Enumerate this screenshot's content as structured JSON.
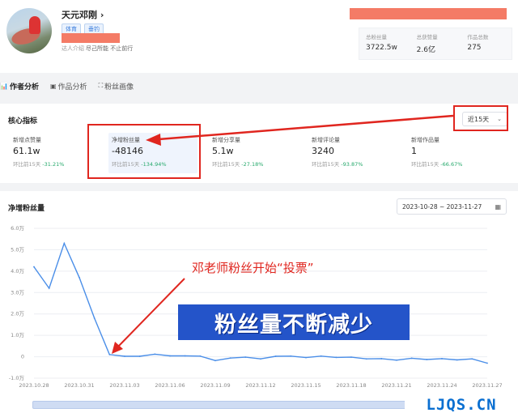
{
  "profile": {
    "name": "天元邓刚",
    "name_chevron": "›",
    "tags": [
      "体育",
      "垂钓"
    ],
    "intro_label": "达人介绍",
    "intro_text": "尽己所能 不止前行"
  },
  "stats": [
    {
      "label": "总粉丝量",
      "value": "3722.5w"
    },
    {
      "label": "总获赞量",
      "value": "2.6亿"
    },
    {
      "label": "作品总数",
      "value": "275"
    }
  ],
  "tabs": [
    {
      "icon": "📊",
      "label": "作者分析"
    },
    {
      "icon": "▣",
      "label": "作品分析"
    },
    {
      "icon": "⛶",
      "label": "粉丝画像"
    }
  ],
  "core": {
    "title": "核心指标",
    "range_value": "近15天",
    "compare_label": "环比前15天",
    "metrics": [
      {
        "label": "新增点赞量",
        "value": "61.1w",
        "change": "-31.21%"
      },
      {
        "label": "净增粉丝量",
        "value": "-48146",
        "change": "-134.94%"
      },
      {
        "label": "新增分享量",
        "value": "5.1w",
        "change": "-27.18%"
      },
      {
        "label": "新增评论量",
        "value": "3240",
        "change": "-93.87%"
      },
      {
        "label": "新增作品量",
        "value": "1",
        "change": "-66.67%"
      }
    ]
  },
  "chart_section": {
    "title": "净增粉丝量",
    "date_range": "2023-10-28 ~ 2023-11-27"
  },
  "chart_data": {
    "type": "line",
    "x": [
      "2023.10.28",
      "2023.10.29",
      "2023.10.30",
      "2023.10.31",
      "2023.11.01",
      "2023.11.02",
      "2023.11.03",
      "2023.11.04",
      "2023.11.05",
      "2023.11.06",
      "2023.11.07",
      "2023.11.08",
      "2023.11.09",
      "2023.11.10",
      "2023.11.11",
      "2023.11.12",
      "2023.11.13",
      "2023.11.14",
      "2023.11.15",
      "2023.11.16",
      "2023.11.17",
      "2023.11.18",
      "2023.11.19",
      "2023.11.20",
      "2023.11.21",
      "2023.11.22",
      "2023.11.23",
      "2023.11.24",
      "2023.11.25",
      "2023.11.26",
      "2023.11.27"
    ],
    "y": [
      42000,
      32000,
      53000,
      37000,
      18000,
      1000,
      200,
      200,
      1200,
      400,
      400,
      300,
      -1800,
      -600,
      -200,
      -1000,
      200,
      300,
      -400,
      300,
      -300,
      -200,
      -1000,
      -900,
      -1600,
      -700,
      -1300,
      -900,
      -1500,
      -1000,
      -3000
    ],
    "xticks": [
      "2023.10.28",
      "2023.10.31",
      "2023.11.03",
      "2023.11.06",
      "2023.11.09",
      "2023.11.12",
      "2023.11.15",
      "2023.11.18",
      "2023.11.21",
      "2023.11.24",
      "2023.11.27"
    ],
    "yticks": [
      "6.0万",
      "5.0万",
      "4.0万",
      "3.0万",
      "2.0万",
      "1.0万",
      "0",
      "-1.0万"
    ],
    "ylim": [
      -10000,
      60000
    ],
    "color": "#4a8ee8",
    "grid": true
  },
  "annotations": {
    "caption": "邓老师粉丝开始“投票”",
    "stamp": "粉丝量不断减少",
    "color": "#e0261f",
    "stamp_color": "#2454c9"
  },
  "watermark": "LJQS.CN"
}
